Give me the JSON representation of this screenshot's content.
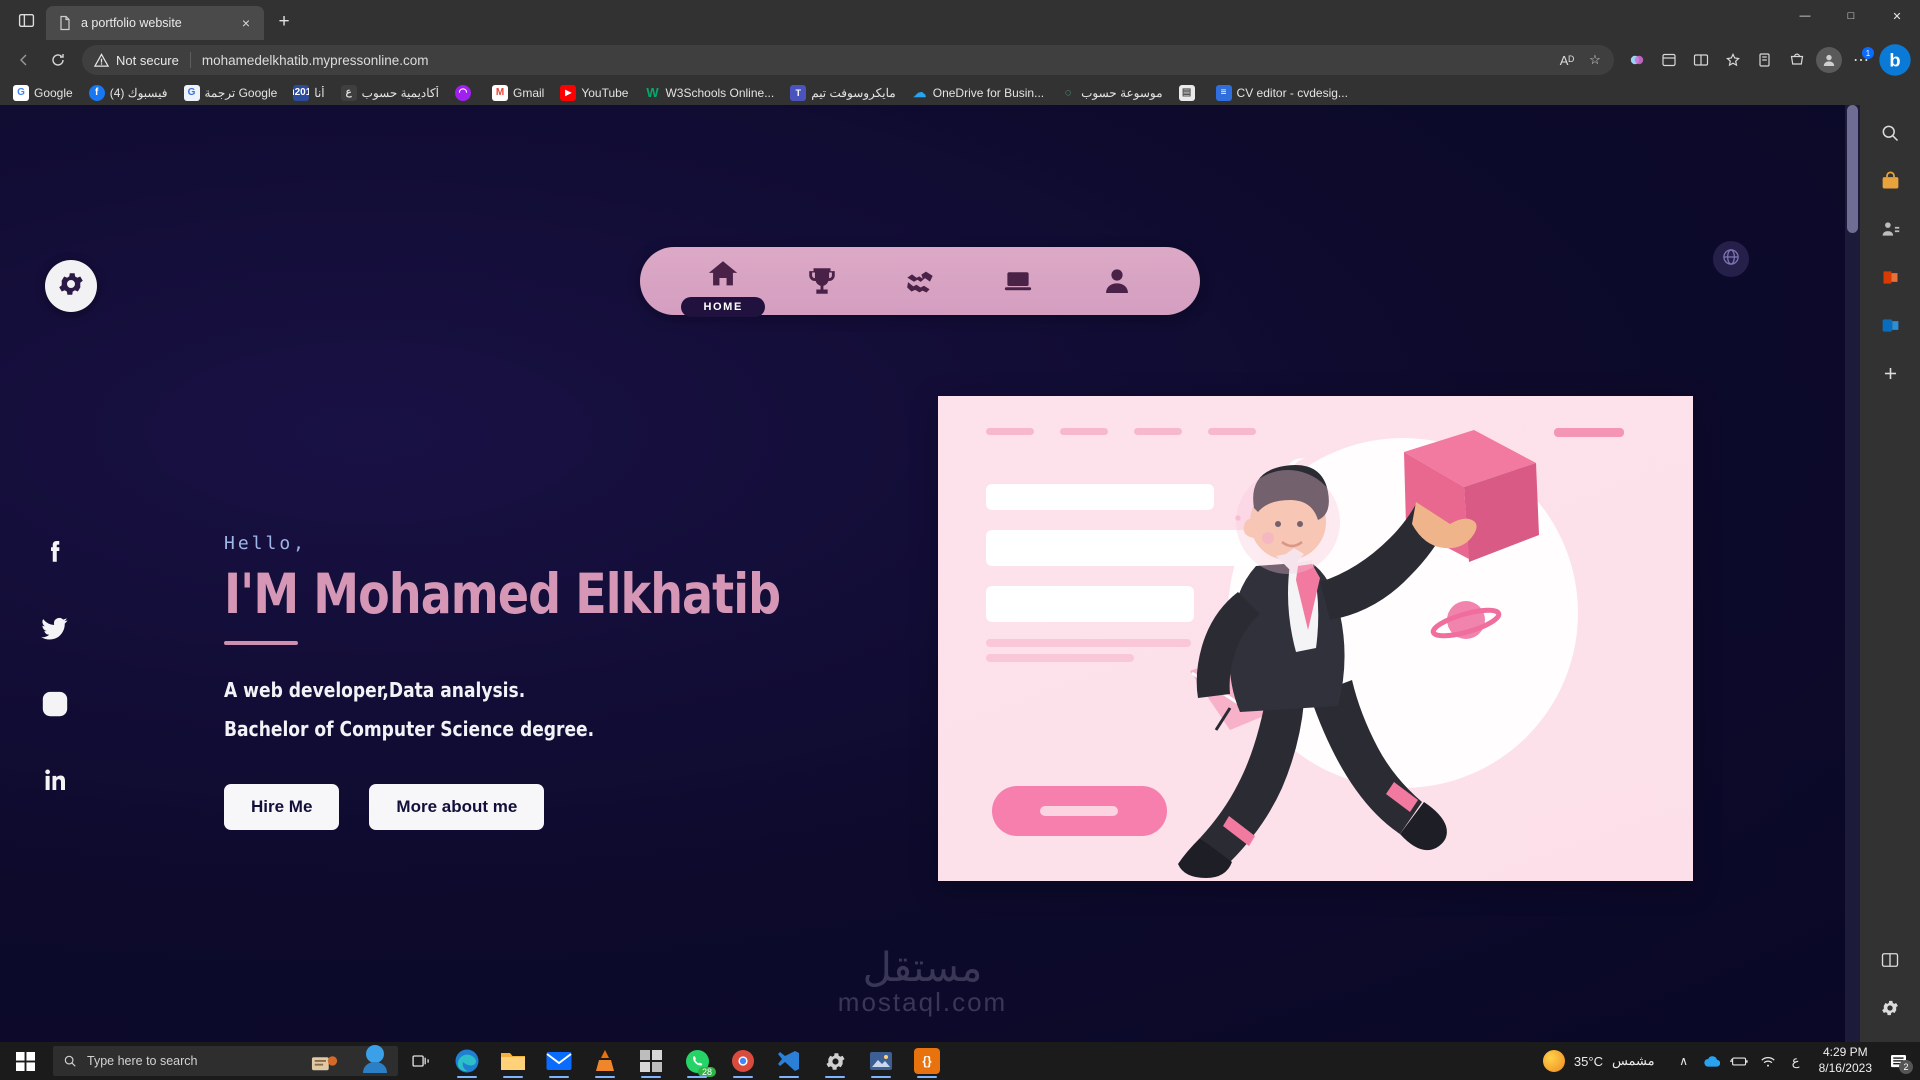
{
  "browser": {
    "tab": {
      "title": "a portfolio website",
      "favicon": "page-icon",
      "close": "×"
    },
    "newtab_label": "+",
    "tab_search_icon": "tab-list-icon",
    "window_controls": {
      "minimize": "—",
      "maximize": "□",
      "close": "✕"
    },
    "nav": {
      "back": "←",
      "refresh": "↻"
    },
    "omnibox": {
      "security_label": "Not secure",
      "url": "mohamedelkhatib.mypressonline.com",
      "read_aloud_label": "Aᴰ",
      "favorite_label": "☆"
    },
    "toolbar_icons": [
      "browser-essentials-icon",
      "collections-split-icon",
      "split-screen-icon",
      "favorites-icon",
      "collections-icon",
      "shopping-icon"
    ],
    "profile_label": "●",
    "more_label": "⋯",
    "copilot_label": "b",
    "bookmarks": [
      {
        "label": "Google",
        "icon": "G",
        "color": "#ffffff",
        "fg": "#4285f4",
        "rtl": false
      },
      {
        "label": "فيسبوك (4)",
        "icon": "f",
        "color": "#1877f2",
        "fg": "#ffffff",
        "rtl": true
      },
      {
        "label": "Google ترجمة",
        "icon": "G",
        "color": "#ffffff",
        "fg": "#4285f4",
        "rtl": true
      },
      {
        "label": "أنا",
        "icon": "‖",
        "color": "#2b4c9b",
        "fg": "#ffffff",
        "rtl": true
      },
      {
        "label": "أكاديمية حسوب",
        "icon": "ع",
        "color": "#3f3f3f",
        "fg": "#dddddd",
        "rtl": true
      },
      {
        "label": "",
        "icon": "∩",
        "color": "#a020f0",
        "fg": "#ffffff",
        "rtl": false
      },
      {
        "label": "Gmail",
        "icon": "M",
        "color": "#ffffff",
        "fg": "#ea4335",
        "rtl": false
      },
      {
        "label": "YouTube",
        "icon": "▶",
        "color": "#ff0000",
        "fg": "#ffffff",
        "rtl": false
      },
      {
        "label": "W3Schools Online...",
        "icon": "W",
        "color": "#04aa6d",
        "fg": "#ffffff",
        "rtl": false
      },
      {
        "label": "مايكروسوفت تيم",
        "icon": "T",
        "color": "#4b53bc",
        "fg": "#ffffff",
        "rtl": true
      },
      {
        "label": "OneDrive for Busin...",
        "icon": "☁",
        "color": "#0f6cbd",
        "fg": "#ffffff",
        "rtl": false
      },
      {
        "label": "موسوعة حسوب",
        "icon": "◌",
        "color": "#1e5b3a",
        "fg": "#5bd69a",
        "rtl": true
      },
      {
        "label": "",
        "icon": "☰",
        "color": "#3a3a3a",
        "fg": "#cccccc",
        "rtl": false
      },
      {
        "label": "CV editor - cvdesig...",
        "icon": "≡",
        "color": "#2f6fdd",
        "fg": "#ffffff",
        "rtl": false
      }
    ]
  },
  "site": {
    "settings_icon": "gear-icon",
    "topright_icon": "globe-icon",
    "nav_items": [
      {
        "icon": "home-icon",
        "label": "HOME",
        "active": true
      },
      {
        "icon": "trophy-icon",
        "label": "",
        "active": false
      },
      {
        "icon": "handshake-icon",
        "label": "",
        "active": false
      },
      {
        "icon": "laptop-icon",
        "label": "",
        "active": false
      },
      {
        "icon": "person-icon",
        "label": "",
        "active": false
      }
    ],
    "social": [
      {
        "name": "facebook-icon"
      },
      {
        "name": "twitter-icon"
      },
      {
        "name": "instagram-icon"
      },
      {
        "name": "linkedin-icon"
      }
    ],
    "hero": {
      "greeting": "Hello,",
      "name": "I'M Mohamed Elkhatib",
      "tagline_1": "A web developer,Data analysis.",
      "tagline_2": "Bachelor of Computer Science degree.",
      "btn_primary": "Hire Me",
      "btn_secondary": "More about me"
    },
    "watermark": {
      "arabic": "مستقل",
      "latin": "mostaql.com"
    },
    "colors": {
      "bg_dark": "#0c0a2e",
      "accent_pink": "#d597b5",
      "nav_pill": "#dca9c6",
      "card_pink": "#fde2ec",
      "hot_pink": "#f77fae",
      "text_light": "#f2f3f7",
      "hello_blue": "#9fb6e8"
    }
  },
  "taskbar": {
    "start_label": "start-icon",
    "search_placeholder": "Type here to search",
    "task_view_label": "task-view-icon",
    "apps": [
      {
        "name": "edge",
        "glyph": "e",
        "color": "#1f7fd1",
        "running": true,
        "count": ""
      },
      {
        "name": "file-explorer",
        "glyph": "▤",
        "color": "#f3b23c",
        "running": true,
        "count": ""
      },
      {
        "name": "mail",
        "glyph": "✉",
        "color": "#0a6cff",
        "running": true,
        "count": ""
      },
      {
        "name": "vlc",
        "glyph": "▲",
        "color": "#e8730e",
        "running": true,
        "count": ""
      },
      {
        "name": "microsoft-store",
        "glyph": "⊞",
        "color": "#9b9b9b",
        "running": true,
        "count": ""
      },
      {
        "name": "whatsapp",
        "glyph": "✆",
        "color": "#25d366",
        "running": true,
        "count": "28"
      },
      {
        "name": "chrome",
        "glyph": "●",
        "color": "#d94c3d",
        "running": true,
        "count": ""
      },
      {
        "name": "vs-code",
        "glyph": "⌨",
        "color": "#2c7fd6",
        "running": true,
        "count": ""
      },
      {
        "name": "settings",
        "glyph": "⚙",
        "color": "#8e8e8e",
        "running": true,
        "count": ""
      },
      {
        "name": "photos",
        "glyph": "⛰",
        "color": "#4a78c8",
        "running": true,
        "count": ""
      },
      {
        "name": "brackets",
        "glyph": "⌘",
        "color": "#e8730e",
        "running": true,
        "count": ""
      }
    ],
    "weather": {
      "temp": "35°C",
      "condition": "مشمس"
    },
    "tray": {
      "chevron": "∧",
      "onedrive": "onedrive-icon",
      "battery": "battery-icon",
      "network": "wifi-icon",
      "language": "ع"
    },
    "clock": {
      "time": "4:29 PM",
      "date": "8/16/2023"
    },
    "notifications": {
      "icon": "notification-icon",
      "count": "2"
    }
  }
}
